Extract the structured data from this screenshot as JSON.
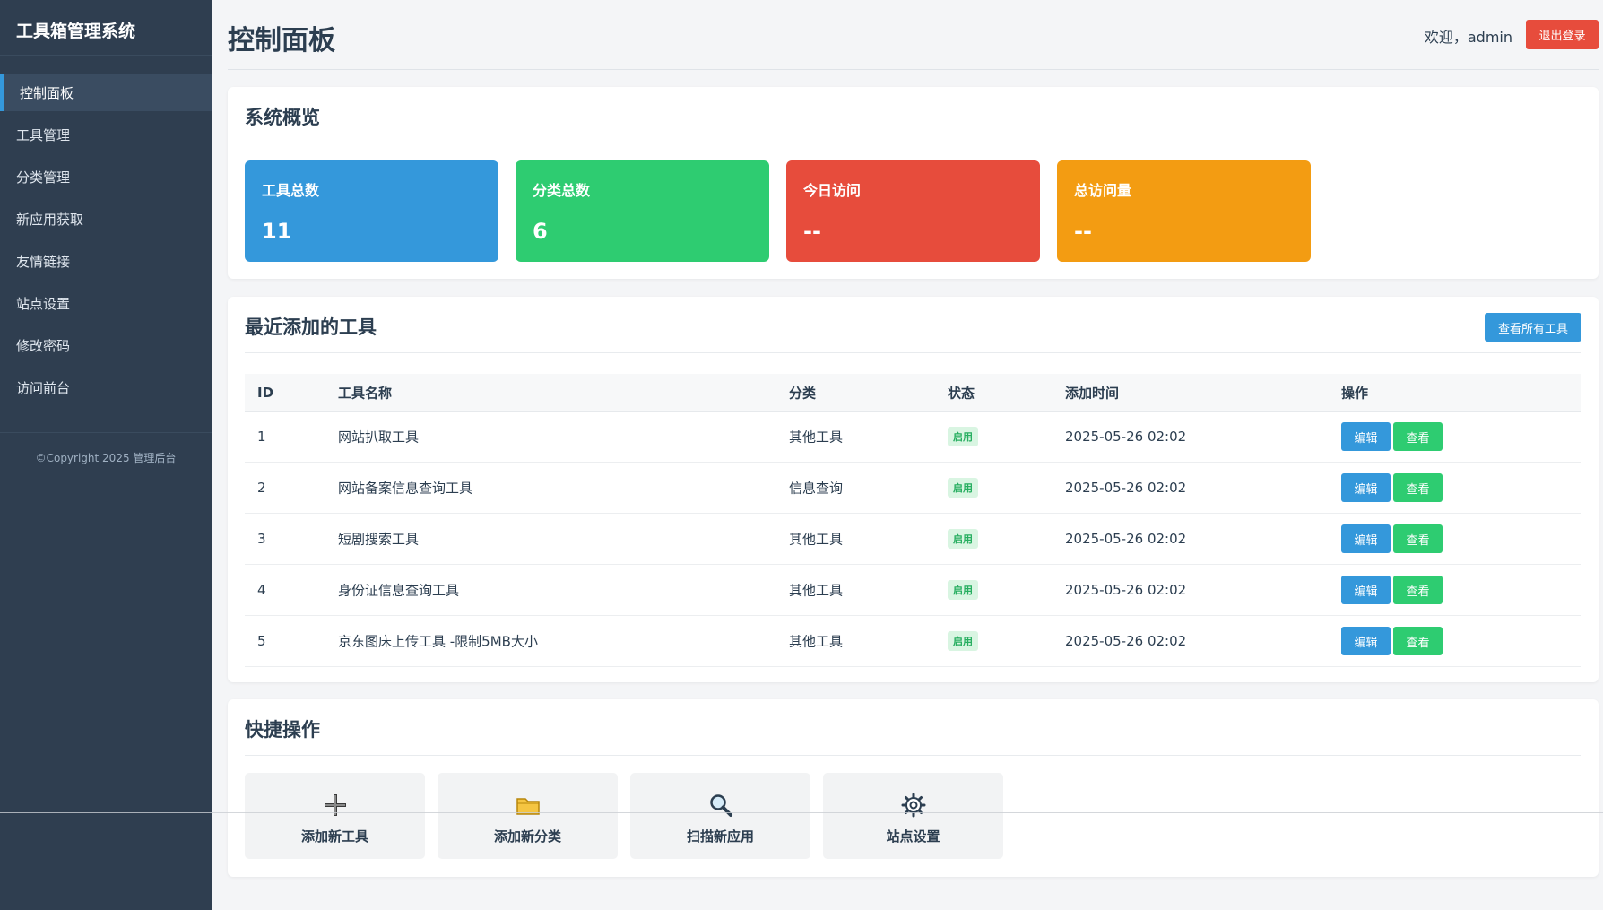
{
  "sidebar": {
    "brand": "工具箱管理系统",
    "items": [
      {
        "label": "控制面板"
      },
      {
        "label": "工具管理"
      },
      {
        "label": "分类管理"
      },
      {
        "label": "新应用获取"
      },
      {
        "label": "友情链接"
      },
      {
        "label": "站点设置"
      },
      {
        "label": "修改密码"
      },
      {
        "label": "访问前台"
      }
    ],
    "copyright": "©Copyright 2025 管理后台"
  },
  "header": {
    "title": "控制面板",
    "welcome": "欢迎，admin",
    "logout_label": "退出登录"
  },
  "overview": {
    "title": "系统概览",
    "stats": [
      {
        "label": "工具总数",
        "value": "11",
        "color": "#3498db"
      },
      {
        "label": "分类总数",
        "value": "6",
        "color": "#2ecc71"
      },
      {
        "label": "今日访问",
        "value": "--",
        "color": "#e74c3c"
      },
      {
        "label": "总访问量",
        "value": "--",
        "color": "#f39c12"
      }
    ]
  },
  "recent": {
    "title": "最近添加的工具",
    "view_all_label": "查看所有工具",
    "columns": [
      "ID",
      "工具名称",
      "分类",
      "状态",
      "添加时间",
      "操作"
    ],
    "rows": [
      {
        "id": "1",
        "name": "网站扒取工具",
        "category": "其他工具",
        "status": "启用",
        "time": "2025-05-26 02:02"
      },
      {
        "id": "2",
        "name": "网站备案信息查询工具",
        "category": "信息查询",
        "status": "启用",
        "time": "2025-05-26 02:02"
      },
      {
        "id": "3",
        "name": "短剧搜索工具",
        "category": "其他工具",
        "status": "启用",
        "time": "2025-05-26 02:02"
      },
      {
        "id": "4",
        "name": "身份证信息查询工具",
        "category": "其他工具",
        "status": "启用",
        "time": "2025-05-26 02:02"
      },
      {
        "id": "5",
        "name": "京东图床上传工具 -限制5MB大小",
        "category": "其他工具",
        "status": "启用",
        "time": "2025-05-26 02:02"
      }
    ],
    "edit_label": "编辑",
    "view_label": "查看"
  },
  "quick": {
    "title": "快捷操作",
    "actions": [
      {
        "label": "添加新工具",
        "icon": "plus-icon"
      },
      {
        "label": "添加新分类",
        "icon": "folder-icon"
      },
      {
        "label": "扫描新应用",
        "icon": "magnifier-icon"
      },
      {
        "label": "站点设置",
        "icon": "gear-icon"
      }
    ]
  }
}
